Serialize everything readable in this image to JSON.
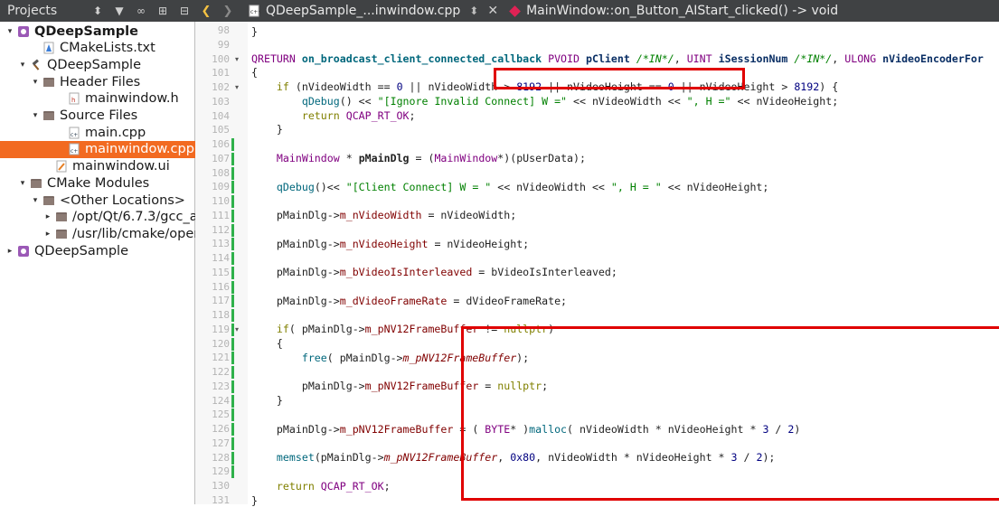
{
  "projects_panel": {
    "title": "Projects",
    "tree": [
      {
        "label": "QDeepSample",
        "arrow": "▾",
        "icon": "project",
        "bold": true,
        "indent": 6
      },
      {
        "label": "CMakeLists.txt",
        "arrow": "",
        "icon": "cmake-file",
        "indent": 34
      },
      {
        "label": "QDeepSample",
        "arrow": "▾",
        "icon": "hammer",
        "indent": 20
      },
      {
        "label": "Header Files",
        "arrow": "▾",
        "icon": "folder",
        "indent": 34
      },
      {
        "label": "mainwindow.h",
        "arrow": "",
        "icon": "header-file",
        "indent": 62
      },
      {
        "label": "Source Files",
        "arrow": "▾",
        "icon": "folder",
        "indent": 34
      },
      {
        "label": "main.cpp",
        "arrow": "",
        "icon": "cpp-file",
        "indent": 62
      },
      {
        "label": "mainwindow.cpp",
        "arrow": "",
        "icon": "cpp-file",
        "indent": 62,
        "selected": true
      },
      {
        "label": "mainwindow.ui",
        "arrow": "",
        "icon": "ui-file",
        "indent": 48
      },
      {
        "label": "CMake Modules",
        "arrow": "▾",
        "icon": "folder",
        "indent": 20
      },
      {
        "label": "<Other Locations>",
        "arrow": "▾",
        "icon": "folder",
        "indent": 34
      },
      {
        "label": "/opt/Qt/6.7.3/gcc_a",
        "arrow": "▸",
        "icon": "folder",
        "indent": 48
      },
      {
        "label": "/usr/lib/cmake/oper",
        "arrow": "▸",
        "icon": "folder",
        "indent": 48
      },
      {
        "label": "QDeepSample",
        "arrow": "▸",
        "icon": "project",
        "indent": 6
      }
    ]
  },
  "editor_toolbar": {
    "file_name": "QDeepSample_...inwindow.cpp",
    "symbol": "MainWindow::on_Button_AIStart_clicked() -> void"
  },
  "line_numbers": [
    "98",
    "99",
    "100",
    "101",
    "102",
    "103",
    "104",
    "105",
    "106",
    "107",
    "108",
    "109",
    "110",
    "111",
    "112",
    "113",
    "114",
    "115",
    "116",
    "117",
    "118",
    "119",
    "120",
    "121",
    "122",
    "123",
    "124",
    "125",
    "126",
    "127",
    "128",
    "129",
    "130",
    "131"
  ],
  "code": {
    "l98": "}",
    "l100_ret": "QRETURN",
    "l100_fn": "on_broadcast_client_connected_callback",
    "l100_p1t": "PVOID",
    "l100_p1": "pClient",
    "l100_c1": "/*IN*/",
    "l100_p2t": "UINT",
    "l100_p2": "iSessionNum",
    "l100_c2": "/*IN*/",
    "l100_p3t": "ULONG",
    "l100_p3": "nVideoEncoderFor",
    "l101": "{",
    "l102_kw": "if",
    "l102_a": " (nVideoWidth == ",
    "l102_n1": "0",
    "l102_b": " || nVideoWidth > ",
    "l102_n2": "8192",
    "l102_c": " || nVideoHeight == ",
    "l102_n3": "0",
    "l102_d": " || nVideoHeight > ",
    "l102_n4": "8192",
    "l102_e": ") {",
    "l103_fn": "qDebug",
    "l103_a": "() << ",
    "l103_s": "\"[Ignore Invalid Connect] W =\"",
    "l103_b": " << nVideoWidth << ",
    "l103_s2": "\", H =\"",
    "l103_c": " << nVideoHeight;",
    "l104_kw": "return",
    "l104_v": "QCAP_RT_OK",
    "l104_e": ";",
    "l105": "}",
    "l107_t": "MainWindow",
    "l107_a": " * ",
    "l107_v": "pMainDlg",
    "l107_b": " = (",
    "l107_t2": "MainWindow",
    "l107_c": "*)(pUserData);",
    "l109_fn": "qDebug",
    "l109_a": "()<< ",
    "l109_s": "\"[Client Connect] W = \"",
    "l109_b": " << nVideoWidth << ",
    "l109_s2": "\", H = \"",
    "l109_c": " << nVideoHeight;",
    "l111_a": "pMainDlg->",
    "l111_m": "m_nVideoWidth",
    "l111_b": " = nVideoWidth;",
    "l113_a": "pMainDlg->",
    "l113_m": "m_nVideoHeight",
    "l113_b": " = nVideoHeight;",
    "l115_a": "pMainDlg->",
    "l115_m": "m_bVideoIsInterleaved",
    "l115_b": " = bVideoIsInterleaved;",
    "l117_a": "pMainDlg->",
    "l117_m": "m_dVideoFrameRate",
    "l117_b": " = dVideoFrameRate;",
    "l119_kw": "if",
    "l119_a": "( pMainDlg->",
    "l119_m": "m_pNV12FrameBuffer",
    "l119_b": " != ",
    "l119_kw2": "nullptr",
    "l119_c": ")",
    "l120": "{",
    "l121_fn": "free",
    "l121_a": "( pMainDlg->",
    "l121_m": "m_pNV12FrameBuffer",
    "l121_b": ");",
    "l123_a": "pMainDlg->",
    "l123_m": "m_pNV12FrameBuffer",
    "l123_b": " = ",
    "l123_kw": "nullptr",
    "l123_c": ";",
    "l124": "}",
    "l126_a": "pMainDlg->",
    "l126_m": "m_pNV12FrameBuffer",
    "l126_b": " = ( ",
    "l126_t": "BYTE",
    "l126_c": "* )",
    "l126_fn": "malloc",
    "l126_d": "( nVideoWidth * nVideoHeight * ",
    "l126_n1": "3",
    "l126_e": " / ",
    "l126_n2": "2",
    "l126_f": ")",
    "l128_fn": "memset",
    "l128_a": "(pMainDlg->",
    "l128_m": "m_pNV12FrameBuffer",
    "l128_b": ", ",
    "l128_n0": "0x80",
    "l128_c": ", nVideoWidth * nVideoHeight * ",
    "l128_n1": "3",
    "l128_d": " / ",
    "l128_n2": "2",
    "l128_e": ");",
    "l130_kw": "return",
    "l130_v": "QCAP_RT_OK",
    "l130_e": ";",
    "l131": "}"
  },
  "colors": {
    "selection": "#f26a21",
    "highlight_box": "#e00000",
    "change_marker": "#2fb14b"
  }
}
